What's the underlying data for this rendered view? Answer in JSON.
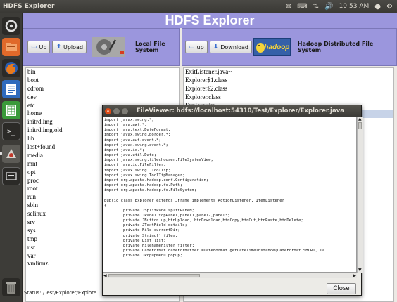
{
  "top_panel": {
    "title": "HDFS Explorer",
    "clock": "10:53 AM"
  },
  "app": {
    "header": "HDFS Explorer",
    "left_toolbar": {
      "up_label": "Up",
      "upload_label": "Upload",
      "panel_label": "Local File System"
    },
    "right_toolbar": {
      "up_label": "up",
      "download_label": "Download",
      "logo_text": "hadoop",
      "panel_label": "Hadoop Distributed File System"
    },
    "local_files": [
      "bin",
      "boot",
      "cdrom",
      "dev",
      "etc",
      "home",
      "initrd.img",
      "initrd.img.old",
      "lib",
      "lost+found",
      "media",
      "mnt",
      "opt",
      "proc",
      "root",
      "run",
      "sbin",
      "selinux",
      "srv",
      "sys",
      "tmp",
      "usr",
      "var",
      "vmlinuz"
    ],
    "hdfs_files": [
      "ExitListener.java~",
      "Explorer$1.class",
      "Explorer$2.class",
      "Explorer.class",
      "Explorer.jar",
      "Explorer.java"
    ],
    "hdfs_selected": "Explorer.java",
    "status": "Status: /Test/Explorer/Explore"
  },
  "viewer": {
    "title": "FileViewer: hdfs://localhost:54310/Test/Explorer/Explorer.java",
    "close_label": "Close",
    "code": "import javax.swing.*;\nimport java.awt.*;\nimport java.text.DateFormat;\nimport javax.swing.border.*;\nimport java.awt.event.*;\nimport javax.swing.event.*;\nimport java.io.*;\nimport java.util.Date;\nimport javax.swing.filechooser.FileSystemView;\nimport java.io.FileFilter;\nimport javax.swing.JToolTip;\nimport javax.swing.ToolTipManager;\nimport org.apache.hadoop.conf.Configuration;\nimport org.apache.hadoop.fs.Path;\nimport org.apache.hadoop.fs.FileSystem;\n\npublic class Explorer extends JFrame implements ActionListener, ItemListener\n{\n        private JSplitPane splitPaneH;\n        private JPanel topPanel,panel1,panel2,panel3;\n        private JButton up,btnUpload, btnDownload,btnCopy,btnCut,btnPaste,btnDelete;\n        private JTextField details;\n        private File currentDir;\n        private String[] files;\n        private List list;\n        private FilenameFilter filter;\n        private DateFormat dateFormatter =DateFormat.getDateTimeInstance(DateFormat.SHORT, Da\n        private JPopupMenu popup;"
  },
  "icons": {
    "launcher": [
      "dash-icon",
      "files-icon",
      "firefox-icon",
      "writer-icon",
      "calc-icon",
      "terminal-icon",
      "software-center-icon",
      "system-settings-icon",
      "trash-icon"
    ]
  },
  "colors": {
    "header": "#9b96dd",
    "selection": "#c7d3e8",
    "panel": "#3c3b37"
  }
}
